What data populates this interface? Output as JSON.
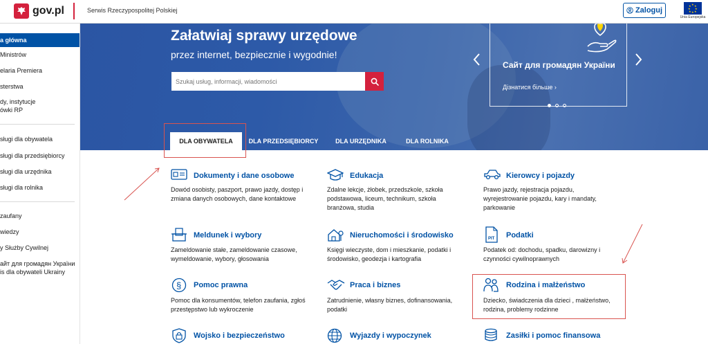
{
  "header": {
    "logo_text": "gov.pl",
    "service_name": "Serwis Rzeczypospolitej Polskiej",
    "login_label": "Zaloguj",
    "eu_text": "Unia Europejska"
  },
  "sidebar": {
    "items": [
      "a główna",
      " Ministrów",
      "elaria Premiera",
      "sterstwa",
      "dy, instytucje",
      "ówki RP",
      "sługi dla obywatela",
      "sługi dla przedsiębiorcy",
      "sługi dla urzędnika",
      "sługi dla rolnika",
      "zaufany",
      "wiedzy",
      "y Służby Cywilnej",
      "айт для громадян України",
      "is dla obywateli Ukrainy"
    ]
  },
  "hero": {
    "title": "Załatwiaj sprawy urzędowe",
    "subtitle": "przez internet, bezpiecznie i wygodnie!",
    "search_placeholder": "Szukaj usług, informacji, wiadomości",
    "card_title": "Сайт для громадян України",
    "card_link": "Дізнатися більше ›"
  },
  "tabs": [
    "DLA OBYWATELA",
    "DLA PRZEDSIĘBIORCY",
    "DLA URZĘDNIKA",
    "DLA ROLNIKA"
  ],
  "categories": [
    {
      "title": "Dokumenty i dane osobowe",
      "desc": "Dowód osobisty, paszport, prawo jazdy, dostęp i zmiana danych osobowych, dane kontaktowe",
      "icon": "id-card-icon"
    },
    {
      "title": "Edukacja",
      "desc": "Zdalne lekcje, żłobek, przedszkole, szkoła podstawowa, liceum, technikum, szkoła branżowa, studia",
      "icon": "graduation-cap-icon"
    },
    {
      "title": "Kierowcy i pojazdy",
      "desc": "Prawo jazdy, rejestracja pojazdu, wyrejestrowanie pojazdu, kary i mandaty, parkowanie",
      "icon": "car-icon"
    },
    {
      "title": "Meldunek i wybory",
      "desc": "Zameldowanie stałe, zameldowanie czasowe, wymeldowanie, wybory, głosowania",
      "icon": "ballot-icon"
    },
    {
      "title": "Nieruchomości i środowisko",
      "desc": "Księgi wieczyste, dom i mieszkanie, podatki i środowisko, geodezja i kartografia",
      "icon": "house-tree-icon"
    },
    {
      "title": "Podatki",
      "desc": "Podatek od: dochodu, spadku, darowizny i czynności cywilnoprawnych",
      "icon": "pit-form-icon"
    },
    {
      "title": "Pomoc prawna",
      "desc": "Pomoc dla konsumentów, telefon zaufania, zgłoś przestępstwo lub wykroczenie",
      "icon": "paragraph-icon"
    },
    {
      "title": "Praca i biznes",
      "desc": "Zatrudnienie, własny biznes, dofinansowania, podatki",
      "icon": "handshake-icon"
    },
    {
      "title": "Rodzina i małżeństwo",
      "desc": "Dziecko, świadczenia dla dzieci , małżeństwo, rodzina, problemy rodzinne",
      "icon": "family-icon"
    },
    {
      "title": "Wojsko i bezpieczeństwo",
      "desc": "",
      "icon": "shield-lock-icon"
    },
    {
      "title": "Wyjazdy i wypoczynek",
      "desc": "",
      "icon": "globe-icon"
    },
    {
      "title": "Zasiłki i pomoc finansowa",
      "desc": "",
      "icon": "coins-icon"
    }
  ],
  "colors": {
    "brand_blue": "#0052a5",
    "brand_red": "#d4213d",
    "annotation_red": "#d9534f"
  }
}
